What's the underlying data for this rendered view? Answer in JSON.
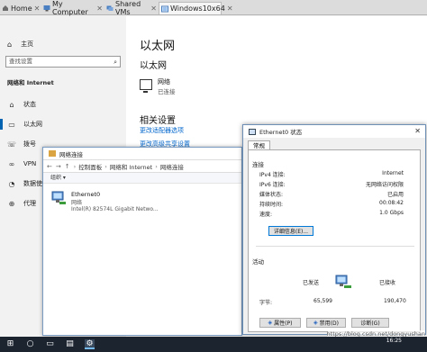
{
  "vm_tabs": [
    {
      "label": "Home",
      "icon": "home-icon"
    },
    {
      "label": "My Computer",
      "icon": "computer-icon"
    },
    {
      "label": "Shared VMs",
      "icon": "shared-vms-icon"
    },
    {
      "label": "Windows10x64",
      "icon": "vm-icon",
      "active": true
    }
  ],
  "settings": {
    "home": "主页",
    "search_placeholder": "查找设置",
    "section": "网络和 Internet",
    "nav": [
      "状态",
      "以太网",
      "拨号",
      "VPN",
      "数据使用量",
      "代理"
    ],
    "active_nav": 1,
    "title": "以太网",
    "subtitle": "以太网",
    "network_name": "网络",
    "network_status": "已连接",
    "related_title": "相关设置",
    "links": [
      "更改适配器选项",
      "更改高级共享设置"
    ]
  },
  "explorer": {
    "title": "网络连接",
    "breadcrumb": [
      "控制面板",
      "网络和 Internet",
      "网络连接"
    ],
    "command": "组织 ▾",
    "adapter_name": "Ethernet0",
    "adapter_net": "网络",
    "adapter_device": "Intel(R) 82574L Gigabit Netwo..."
  },
  "dialog": {
    "title": "Ethernet0 状态",
    "tab": "常规",
    "connection_group": "连接",
    "rows": [
      {
        "label": "IPv4 连接:",
        "value": "Internet"
      },
      {
        "label": "IPv6 连接:",
        "value": "无网络访问权限"
      },
      {
        "label": "媒体状态:",
        "value": "已启用"
      },
      {
        "label": "持续时间:",
        "value": "00:08:42"
      },
      {
        "label": "速度:",
        "value": "1.0 Gbps"
      }
    ],
    "details_button": "详细信息(E)...",
    "activity_group": "活动",
    "sent_label": "已发送",
    "received_label": "已接收",
    "bytes_label": "字节:",
    "bytes_sent": "65,599",
    "bytes_received": "190,470",
    "btn_properties": "属性(P)",
    "btn_disable": "禁用(D)",
    "btn_diagnose": "诊断(G)"
  },
  "taskbar": {
    "time": "16:25",
    "watermark": "https://blog.csdn.net/dongyushan"
  },
  "colors": {
    "accent": "#0063b1",
    "link": "#0066cc",
    "taskbar": "#1c2430"
  }
}
